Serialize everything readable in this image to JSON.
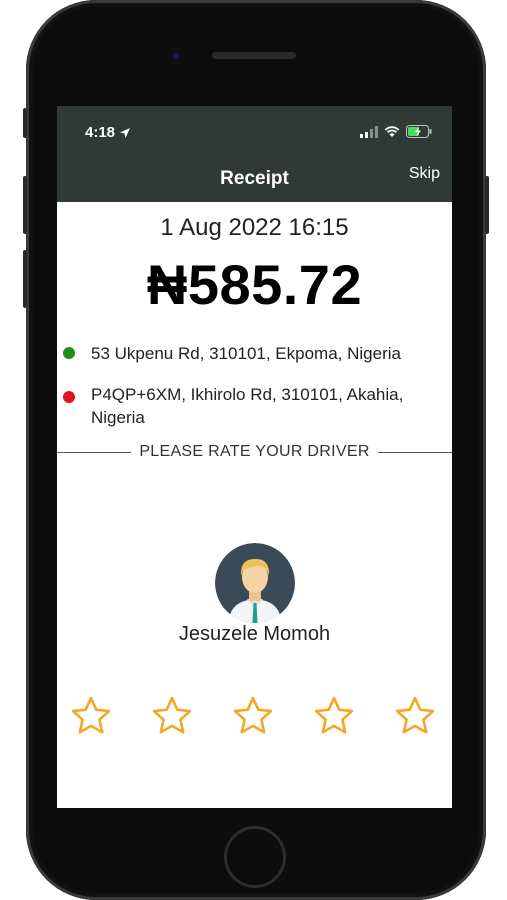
{
  "status_bar": {
    "time": "4:18"
  },
  "header": {
    "title": "Receipt",
    "skip_label": "Skip"
  },
  "receipt": {
    "date": "1 Aug 2022 16:15",
    "amount": "₦585.72"
  },
  "locations": [
    {
      "address": "53 Ukpenu Rd, 310101, Ekpoma, Nigeria",
      "color": "#1a8f1a"
    },
    {
      "address": "P4QP+6XM, Ikhirolo Rd, 310101, Akahia, Nigeria",
      "color": "#e3111b"
    }
  ],
  "rating": {
    "prompt": "PLEASE RATE YOUR DRIVER",
    "driver_name": "Jesuzele Momoh",
    "star_count": 5,
    "selected": 0,
    "star_color": "#f5a623"
  },
  "colors": {
    "header_bg": "#2f3a36",
    "avatar_bg": "#3a4a56"
  }
}
